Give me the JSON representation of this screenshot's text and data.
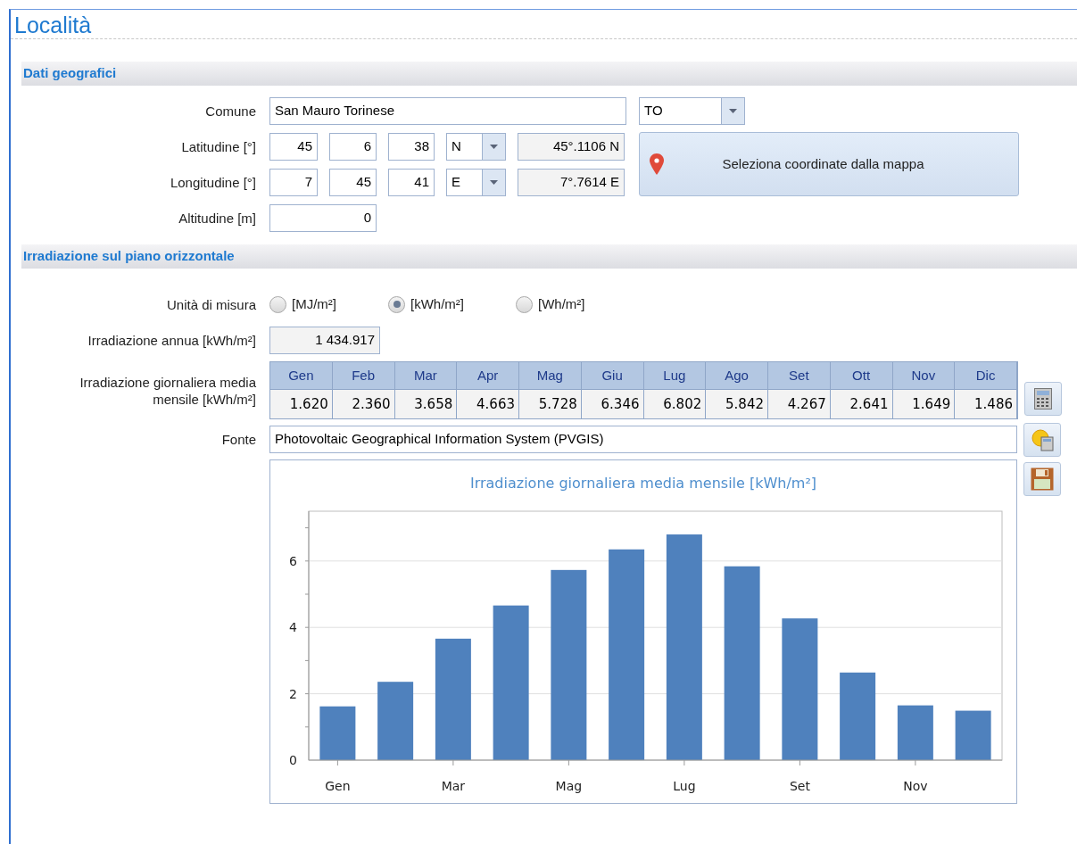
{
  "title": "Località",
  "geo": {
    "title": "Dati geografici",
    "comune": {
      "label": "Comune",
      "value": "San Mauro Torinese"
    },
    "provincia": {
      "value": "TO"
    },
    "coords": [
      {
        "label": "Latitudine [°]",
        "deg": "45",
        "min": "6",
        "sec": "38",
        "hemisphere": "N",
        "decimal": "45°.1106 N"
      },
      {
        "label": "Longitudine [°]",
        "deg": "7",
        "min": "45",
        "sec": "41",
        "hemisphere": "E",
        "decimal": "7°.7614 E"
      }
    ],
    "map_button": "Seleziona coordinate dalla mappa",
    "altitude": {
      "label": "Altitudine [m]",
      "value": "0"
    }
  },
  "irradiation": {
    "title": "Irradiazione sul piano orizzontale",
    "unit_label": "Unità di misura",
    "units": [
      {
        "label": "[MJ/m²]",
        "selected": false
      },
      {
        "label": "[kWh/m²]",
        "selected": true
      },
      {
        "label": "[Wh/m²]",
        "selected": false
      }
    ],
    "annual": {
      "label": "Irradiazione annua [kWh/m²]",
      "value": "1 434.917"
    },
    "monthly_label": "Irradiazione giornaliera media mensile [kWh/m²]",
    "months": [
      {
        "month": "Gen",
        "value": "1.620"
      },
      {
        "month": "Feb",
        "value": "2.360"
      },
      {
        "month": "Mar",
        "value": "3.658"
      },
      {
        "month": "Apr",
        "value": "4.663"
      },
      {
        "month": "Mag",
        "value": "5.728"
      },
      {
        "month": "Giu",
        "value": "6.346"
      },
      {
        "month": "Lug",
        "value": "6.802"
      },
      {
        "month": "Ago",
        "value": "5.842"
      },
      {
        "month": "Set",
        "value": "4.267"
      },
      {
        "month": "Ott",
        "value": "2.641"
      },
      {
        "month": "Nov",
        "value": "1.649"
      },
      {
        "month": "Dic",
        "value": "1.486"
      }
    ],
    "source": {
      "label": "Fonte",
      "value": "Photovoltaic Geographical Information System (PVGIS)"
    },
    "chart_data": {
      "type": "bar",
      "title": "Irradiazione giornaliera media mensile [kWh/m²]",
      "categories": [
        "Gen",
        null,
        "Mar",
        null,
        "Mag",
        null,
        "Lug",
        null,
        "Set",
        null,
        "Nov",
        null
      ],
      "series": [
        {
          "color": "#4f81bd",
          "values": [
            1.62,
            2.36,
            3.66,
            4.66,
            5.73,
            6.35,
            6.8,
            5.84,
            4.27,
            2.64,
            1.65,
            1.49
          ]
        }
      ],
      "ylim": [
        0,
        7.5
      ],
      "yticks": [
        0,
        2,
        4,
        6
      ],
      "grid": true
    }
  }
}
